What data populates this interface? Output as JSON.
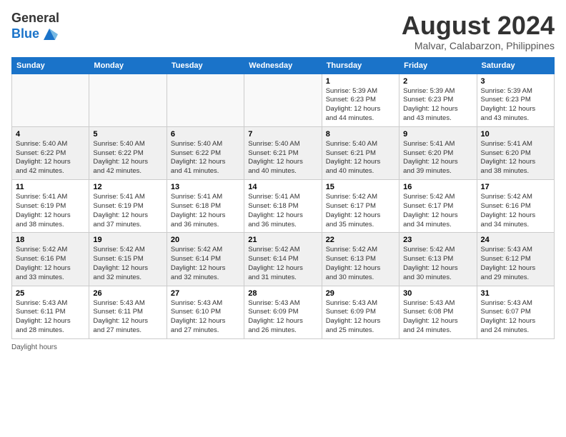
{
  "header": {
    "logo_general": "General",
    "logo_blue": "Blue",
    "month_title": "August 2024",
    "location": "Malvar, Calabarzon, Philippines"
  },
  "days_of_week": [
    "Sunday",
    "Monday",
    "Tuesday",
    "Wednesday",
    "Thursday",
    "Friday",
    "Saturday"
  ],
  "weeks": [
    {
      "days": [
        {
          "num": "",
          "empty": true
        },
        {
          "num": "",
          "empty": true
        },
        {
          "num": "",
          "empty": true
        },
        {
          "num": "",
          "empty": true
        },
        {
          "num": "1",
          "sunrise": "5:39 AM",
          "sunset": "6:23 PM",
          "daylight": "12 hours and 44 minutes."
        },
        {
          "num": "2",
          "sunrise": "5:39 AM",
          "sunset": "6:23 PM",
          "daylight": "12 hours and 43 minutes."
        },
        {
          "num": "3",
          "sunrise": "5:39 AM",
          "sunset": "6:23 PM",
          "daylight": "12 hours and 43 minutes."
        }
      ]
    },
    {
      "shaded": true,
      "days": [
        {
          "num": "4",
          "sunrise": "5:40 AM",
          "sunset": "6:22 PM",
          "daylight": "12 hours and 42 minutes."
        },
        {
          "num": "5",
          "sunrise": "5:40 AM",
          "sunset": "6:22 PM",
          "daylight": "12 hours and 42 minutes."
        },
        {
          "num": "6",
          "sunrise": "5:40 AM",
          "sunset": "6:22 PM",
          "daylight": "12 hours and 41 minutes."
        },
        {
          "num": "7",
          "sunrise": "5:40 AM",
          "sunset": "6:21 PM",
          "daylight": "12 hours and 40 minutes."
        },
        {
          "num": "8",
          "sunrise": "5:40 AM",
          "sunset": "6:21 PM",
          "daylight": "12 hours and 40 minutes."
        },
        {
          "num": "9",
          "sunrise": "5:41 AM",
          "sunset": "6:20 PM",
          "daylight": "12 hours and 39 minutes."
        },
        {
          "num": "10",
          "sunrise": "5:41 AM",
          "sunset": "6:20 PM",
          "daylight": "12 hours and 38 minutes."
        }
      ]
    },
    {
      "days": [
        {
          "num": "11",
          "sunrise": "5:41 AM",
          "sunset": "6:19 PM",
          "daylight": "12 hours and 38 minutes."
        },
        {
          "num": "12",
          "sunrise": "5:41 AM",
          "sunset": "6:19 PM",
          "daylight": "12 hours and 37 minutes."
        },
        {
          "num": "13",
          "sunrise": "5:41 AM",
          "sunset": "6:18 PM",
          "daylight": "12 hours and 36 minutes."
        },
        {
          "num": "14",
          "sunrise": "5:41 AM",
          "sunset": "6:18 PM",
          "daylight": "12 hours and 36 minutes."
        },
        {
          "num": "15",
          "sunrise": "5:42 AM",
          "sunset": "6:17 PM",
          "daylight": "12 hours and 35 minutes."
        },
        {
          "num": "16",
          "sunrise": "5:42 AM",
          "sunset": "6:17 PM",
          "daylight": "12 hours and 34 minutes."
        },
        {
          "num": "17",
          "sunrise": "5:42 AM",
          "sunset": "6:16 PM",
          "daylight": "12 hours and 34 minutes."
        }
      ]
    },
    {
      "shaded": true,
      "days": [
        {
          "num": "18",
          "sunrise": "5:42 AM",
          "sunset": "6:16 PM",
          "daylight": "12 hours and 33 minutes."
        },
        {
          "num": "19",
          "sunrise": "5:42 AM",
          "sunset": "6:15 PM",
          "daylight": "12 hours and 32 minutes."
        },
        {
          "num": "20",
          "sunrise": "5:42 AM",
          "sunset": "6:14 PM",
          "daylight": "12 hours and 32 minutes."
        },
        {
          "num": "21",
          "sunrise": "5:42 AM",
          "sunset": "6:14 PM",
          "daylight": "12 hours and 31 minutes."
        },
        {
          "num": "22",
          "sunrise": "5:42 AM",
          "sunset": "6:13 PM",
          "daylight": "12 hours and 30 minutes."
        },
        {
          "num": "23",
          "sunrise": "5:42 AM",
          "sunset": "6:13 PM",
          "daylight": "12 hours and 30 minutes."
        },
        {
          "num": "24",
          "sunrise": "5:43 AM",
          "sunset": "6:12 PM",
          "daylight": "12 hours and 29 minutes."
        }
      ]
    },
    {
      "days": [
        {
          "num": "25",
          "sunrise": "5:43 AM",
          "sunset": "6:11 PM",
          "daylight": "12 hours and 28 minutes."
        },
        {
          "num": "26",
          "sunrise": "5:43 AM",
          "sunset": "6:11 PM",
          "daylight": "12 hours and 27 minutes."
        },
        {
          "num": "27",
          "sunrise": "5:43 AM",
          "sunset": "6:10 PM",
          "daylight": "12 hours and 27 minutes."
        },
        {
          "num": "28",
          "sunrise": "5:43 AM",
          "sunset": "6:09 PM",
          "daylight": "12 hours and 26 minutes."
        },
        {
          "num": "29",
          "sunrise": "5:43 AM",
          "sunset": "6:09 PM",
          "daylight": "12 hours and 25 minutes."
        },
        {
          "num": "30",
          "sunrise": "5:43 AM",
          "sunset": "6:08 PM",
          "daylight": "12 hours and 24 minutes."
        },
        {
          "num": "31",
          "sunrise": "5:43 AM",
          "sunset": "6:07 PM",
          "daylight": "12 hours and 24 minutes."
        }
      ]
    }
  ],
  "labels": {
    "sunrise": "Sunrise:",
    "sunset": "Sunset:",
    "daylight": "Daylight:",
    "daylight_hours": "Daylight hours"
  }
}
